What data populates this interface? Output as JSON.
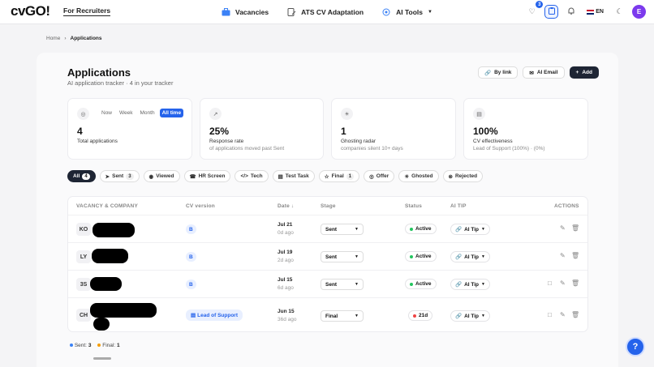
{
  "nav": {
    "logo": "cvGO!",
    "for_recruiters": "For Recruiters",
    "links": [
      {
        "label": "Vacancies",
        "icon": "briefcase-icon"
      },
      {
        "label": "ATS CV Adaptation",
        "icon": "document-edit-icon"
      },
      {
        "label": "AI Tools",
        "icon": "sparkle-icon"
      }
    ],
    "heart_badge": "3",
    "lang": "EN",
    "avatar": "E"
  },
  "breadcrumb": {
    "home": "Home",
    "sep": "›",
    "current": "Applications"
  },
  "page": {
    "title": "Applications",
    "subtitle": "AI application tracker · 4 in your tracker",
    "by_link": "By link",
    "ai_email": "AI Email",
    "add": "Add"
  },
  "stats": {
    "periods": [
      "Now",
      "Week",
      "Month",
      "All time"
    ],
    "selected_period": "All time",
    "total": {
      "value": "4",
      "label": "Total applications"
    },
    "response": {
      "value": "25%",
      "label": "Response rate",
      "sub": "of applications moved past Sent"
    },
    "ghosting": {
      "value": "1",
      "label": "Ghosting radar",
      "sub": "companies silent 10+ days"
    },
    "cv": {
      "value": "100%",
      "label": "CV effectiveness",
      "sub": "Lead of Support (100%) · (0%)"
    }
  },
  "filters": [
    {
      "label": "All",
      "count": "4",
      "selected": true
    },
    {
      "label": "Sent",
      "count": "3"
    },
    {
      "label": "Viewed"
    },
    {
      "label": "HR Screen"
    },
    {
      "label": "Tech"
    },
    {
      "label": "Test Task"
    },
    {
      "label": "Final",
      "count": "1"
    },
    {
      "label": "Offer"
    },
    {
      "label": "Ghosted"
    },
    {
      "label": "Rejected"
    }
  ],
  "table": {
    "headers": {
      "vacancy": "VACANCY & COMPANY",
      "cv": "CV version",
      "date": "Date ↓",
      "stage": "Stage",
      "status": "Status",
      "aitip": "AI TIP",
      "actions": "ACTIONS"
    },
    "rows": [
      {
        "initials": "KO",
        "cv": "B",
        "date": "Jul 21",
        "ago": "0d ago",
        "stage": "Sent",
        "status": "Active",
        "status_color": "#22c55e",
        "aitip": "AI Tip",
        "chat": false
      },
      {
        "initials": "LY",
        "cv": "B",
        "date": "Jul 19",
        "ago": "2d ago",
        "stage": "Sent",
        "status": "Active",
        "status_color": "#22c55e",
        "aitip": "AI Tip",
        "chat": false
      },
      {
        "initials": "3S",
        "cv": "B",
        "date": "Jul 15",
        "ago": "6d ago",
        "stage": "Sent",
        "status": "Active",
        "status_color": "#22c55e",
        "aitip": "AI Tip",
        "chat": true
      },
      {
        "initials": "CH",
        "cv": "Lead of Support",
        "date": "Jun 15",
        "ago": "36d ago",
        "stage": "Final",
        "status": "21d",
        "status_color": "#ef4444",
        "aitip": "AI Tip",
        "chat": true
      }
    ]
  },
  "legend": [
    {
      "label": "Sent:",
      "value": "3",
      "color": "#3b82f6"
    },
    {
      "label": "Final:",
      "value": "1",
      "color": "#f59e0b"
    }
  ],
  "help": "?"
}
